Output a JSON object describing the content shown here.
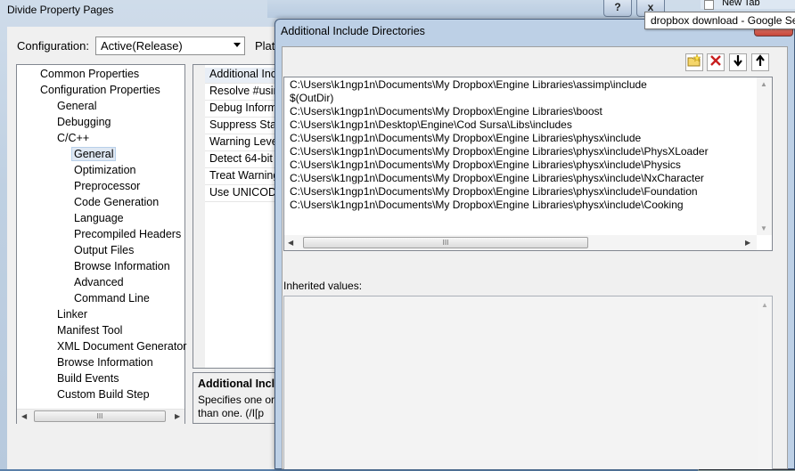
{
  "background_window": {
    "title": "Divide Property Pages",
    "tab_new": "New Tab",
    "btn_help": "?",
    "btn_close": "x",
    "config_label": "Configuration:",
    "config_value": "Active(Release)",
    "platform_label_partial": "Platf"
  },
  "tooltip": "dropbox download - Google Se",
  "tree": {
    "items": [
      {
        "label": "Common Properties"
      },
      {
        "label": "Configuration Properties"
      },
      {
        "label": "General"
      },
      {
        "label": "Debugging"
      },
      {
        "label": "C/C++"
      },
      {
        "label": "General",
        "selected": true
      },
      {
        "label": "Optimization"
      },
      {
        "label": "Preprocessor"
      },
      {
        "label": "Code Generation"
      },
      {
        "label": "Language"
      },
      {
        "label": "Precompiled Headers"
      },
      {
        "label": "Output Files"
      },
      {
        "label": "Browse Information"
      },
      {
        "label": "Advanced"
      },
      {
        "label": "Command Line"
      },
      {
        "label": "Linker"
      },
      {
        "label": "Manifest Tool"
      },
      {
        "label": "XML Document Generator"
      },
      {
        "label": "Browse Information"
      },
      {
        "label": "Build Events"
      },
      {
        "label": "Custom Build Step"
      }
    ],
    "scroll_grip": "III"
  },
  "grid": {
    "rows": [
      "Additional Inc",
      "Resolve #usin",
      "Debug Inform",
      "Suppress Start",
      "Warning Level",
      "Detect 64-bit",
      "Treat Warning",
      "Use UNICODE"
    ]
  },
  "description": {
    "title": "Additional Inclu",
    "line1": "Specifies one or",
    "line2": "than one.    (/I[p"
  },
  "dialog": {
    "title": "Additional Include Directories",
    "close": "✕",
    "max": "□",
    "toolbar": {
      "new_folder_icon": "folder-new-icon",
      "delete_icon": "delete-icon",
      "down_icon": "arrow-down-icon",
      "up_icon": "arrow-up-icon"
    },
    "directories": [
      "C:\\Users\\k1ngp1n\\Documents\\My Dropbox\\Engine Libraries\\assimp\\include",
      "$(OutDir)",
      "C:\\Users\\k1ngp1n\\Documents\\My Dropbox\\Engine Libraries\\boost",
      "C:\\Users\\k1ngp1n\\Desktop\\Engine\\Cod Sursa\\Libs\\includes",
      "C:\\Users\\k1ngp1n\\Documents\\My Dropbox\\Engine Libraries\\physx\\include",
      "C:\\Users\\k1ngp1n\\Documents\\My Dropbox\\Engine Libraries\\physx\\include\\PhysXLoader",
      "C:\\Users\\k1ngp1n\\Documents\\My Dropbox\\Engine Libraries\\physx\\include\\Physics",
      "C:\\Users\\k1ngp1n\\Documents\\My Dropbox\\Engine Libraries\\physx\\include\\NxCharacter",
      "C:\\Users\\k1ngp1n\\Documents\\My Dropbox\\Engine Libraries\\physx\\include\\Foundation",
      "C:\\Users\\k1ngp1n\\Documents\\My Dropbox\\Engine Libraries\\physx\\include\\Cooking"
    ],
    "scroll_grip": "III",
    "inherited_label": "Inherited values:"
  }
}
